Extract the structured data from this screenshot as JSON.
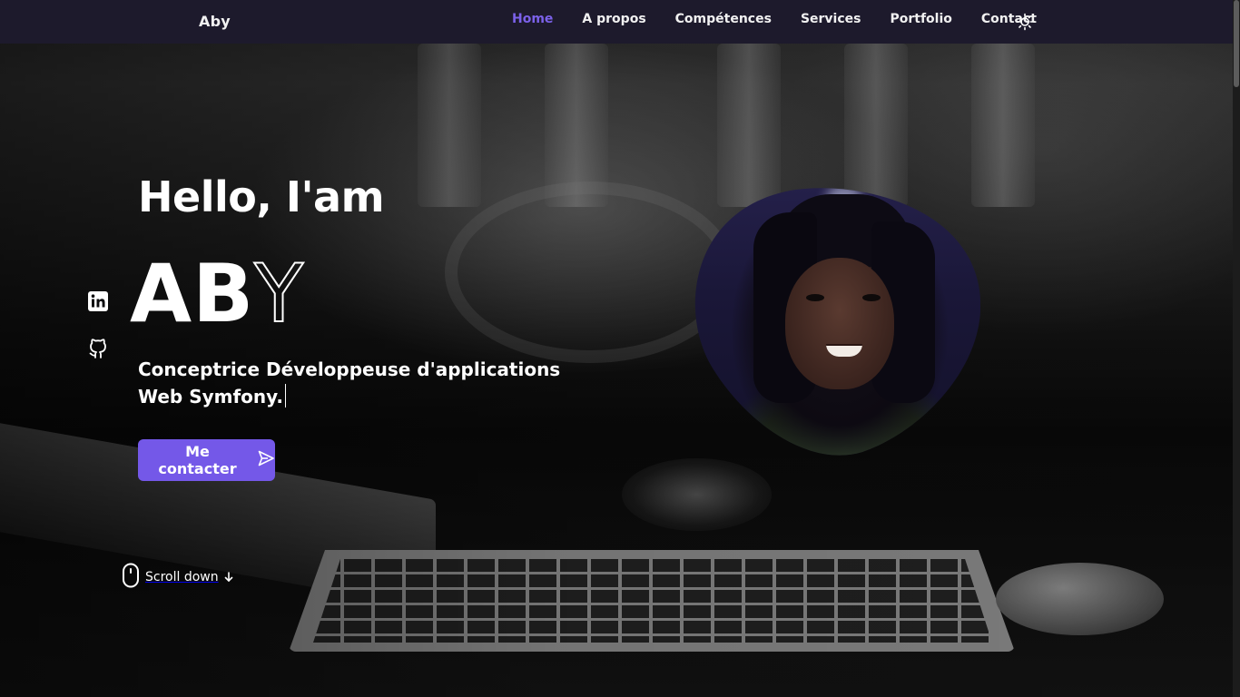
{
  "header": {
    "logo": "Aby",
    "nav": [
      {
        "label": "Home",
        "active": true
      },
      {
        "label": "A propos",
        "active": false
      },
      {
        "label": "Compétences",
        "active": false
      },
      {
        "label": "Services",
        "active": false
      },
      {
        "label": "Portfolio",
        "active": false
      },
      {
        "label": "Contact",
        "active": false
      }
    ],
    "theme_icon": "sun-icon"
  },
  "social": [
    {
      "name": "linkedin",
      "icon": "linkedin-icon"
    },
    {
      "name": "github",
      "icon": "github-icon"
    }
  ],
  "hero": {
    "greeting": "Hello, I'am",
    "name_solid": "AB",
    "name_outline": "Y",
    "role": "Conceptrice Développeuse d'applications Web Symfony.",
    "cta_label": "Me contacter",
    "cta_icon": "send-icon",
    "scroll_label": "Scroll down",
    "scroll_icon": "mouse-icon",
    "scroll_arrow_icon": "arrow-down-icon",
    "portrait": "profile-photo"
  },
  "colors": {
    "accent": "#7458e8",
    "nav_active": "#7b61e9",
    "header_bg": "#1d1a2c",
    "text": "#ffffff"
  }
}
